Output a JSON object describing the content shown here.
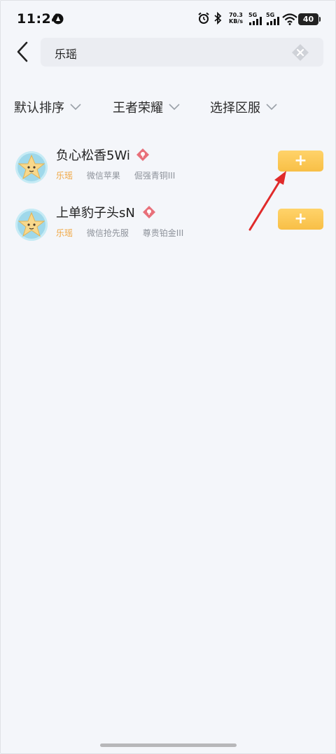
{
  "status_bar": {
    "time": "11:24",
    "net_speed_value": "70.3",
    "net_speed_unit": "KB/s",
    "signal1_label": "5G",
    "signal2_label": "5G",
    "battery": "40"
  },
  "search": {
    "query": "乐瑶"
  },
  "filters": [
    {
      "label": "默认排序"
    },
    {
      "label": "王者荣耀"
    },
    {
      "label": "选择区服"
    }
  ],
  "results": [
    {
      "name": "负心松香5Wi",
      "tag": "乐瑶",
      "server": "微信苹果",
      "rank": "倔强青铜III"
    },
    {
      "name": "上单豹子头sN",
      "tag": "乐瑶",
      "server": "微信抢先服",
      "rank": "尊贵铂金III"
    }
  ],
  "colors": {
    "accent_orange": "#f8bf46",
    "tag_orange": "#f0a640",
    "location_badge": "#e8707a",
    "annotation_arrow": "#e02a2a"
  }
}
